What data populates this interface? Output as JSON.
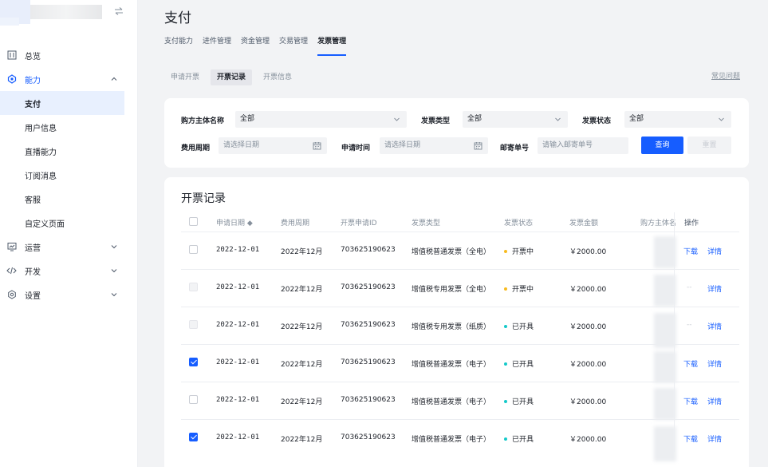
{
  "colors": {
    "accent": "#165dff",
    "status_pending": "#f7ba1e",
    "status_issued": "#14c9c9"
  },
  "sidebar": {
    "items": [
      {
        "label": "总览",
        "icon": "overview-icon"
      },
      {
        "label": "能力",
        "icon": "capability-icon",
        "expanded": true,
        "children": [
          "支付",
          "用户信息",
          "直播能力",
          "订阅消息",
          "客服",
          "自定义页面"
        ]
      },
      {
        "label": "运营",
        "icon": "operation-icon"
      },
      {
        "label": "开发",
        "icon": "code-icon"
      },
      {
        "label": "设置",
        "icon": "settings-icon"
      }
    ]
  },
  "page_title": "支付",
  "top_tabs": [
    "支付能力",
    "进件管理",
    "资金管理",
    "交易管理",
    "发票管理"
  ],
  "sub_tabs": [
    "申请开票",
    "开票记录",
    "开票信息"
  ],
  "faq_link": "常见问题",
  "filters": {
    "buyer_label": "购方主体名称",
    "buyer_value": "全部",
    "invoice_type_label": "发票类型",
    "invoice_type_value": "全部",
    "invoice_status_label": "发票状态",
    "invoice_status_value": "全部",
    "fee_period_label": "费用周期",
    "fee_period_placeholder": "请选择日期",
    "apply_time_label": "申请时间",
    "apply_time_placeholder": "请选择日期",
    "mail_no_label": "邮寄单号",
    "mail_no_placeholder": "请输入邮寄单号",
    "query_button": "查询",
    "reset_button": "重置"
  },
  "table": {
    "title": "开票记录",
    "headers": [
      "申请日期 ◆",
      "费用周期",
      "开票申请ID",
      "发票类型",
      "发票状态",
      "发票金额",
      "购方主体名",
      "操作"
    ],
    "rows": [
      {
        "date": "2022-12-01",
        "period": "2022年12月",
        "id": "703625190623",
        "type": "增值税普通发票（全电）",
        "status": "开票中",
        "amount": "￥2000.00",
        "download": "下载",
        "detail": "详情"
      },
      {
        "date": "2022-12-01",
        "period": "2022年12月",
        "id": "703625190623",
        "type": "增值税专用发票（全电）",
        "status": "开票中",
        "amount": "￥2000.00",
        "download": "--",
        "detail": "详情"
      },
      {
        "date": "2022-12-01",
        "period": "2022年12月",
        "id": "703625190623",
        "type": "增值税专用发票（纸质）",
        "status": "已开具",
        "amount": "￥2000.00",
        "download": "--",
        "detail": "详情"
      },
      {
        "date": "2022-12-01",
        "period": "2022年12月",
        "id": "703625190623",
        "type": "增值税普通发票（电子）",
        "status": "已开具",
        "amount": "￥2000.00",
        "download": "下载",
        "detail": "详情"
      },
      {
        "date": "2022-12-01",
        "period": "2022年12月",
        "id": "703625190623",
        "type": "增值税普通发票（电子）",
        "status": "已开具",
        "amount": "￥2000.00",
        "download": "下载",
        "detail": "详情"
      },
      {
        "date": "2022-12-01",
        "period": "2022年12月",
        "id": "703625190623",
        "type": "增值税普通发票（电子）",
        "status": "已开具",
        "amount": "￥2000.00",
        "download": "下载",
        "detail": "详情"
      }
    ]
  }
}
